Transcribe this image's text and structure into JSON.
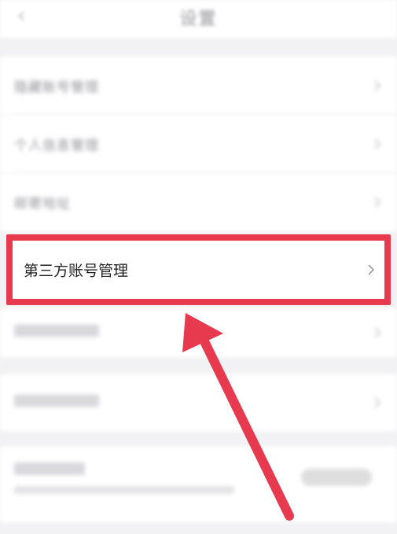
{
  "header": {
    "back_icon": "back-chevron-icon",
    "title": "设置"
  },
  "rows": [
    {
      "label": "隐藏账号管理"
    },
    {
      "label": "个人信息管理"
    },
    {
      "label": "邮寄地址"
    }
  ],
  "highlighted_row": {
    "label": "第三方账号管理",
    "chevron_icon": "chevron-right-icon"
  },
  "colors": {
    "highlight_border": "#e83a4f",
    "arrow": "#e83a4f",
    "background": "#f2f2f4",
    "row_background": "#ffffff"
  }
}
